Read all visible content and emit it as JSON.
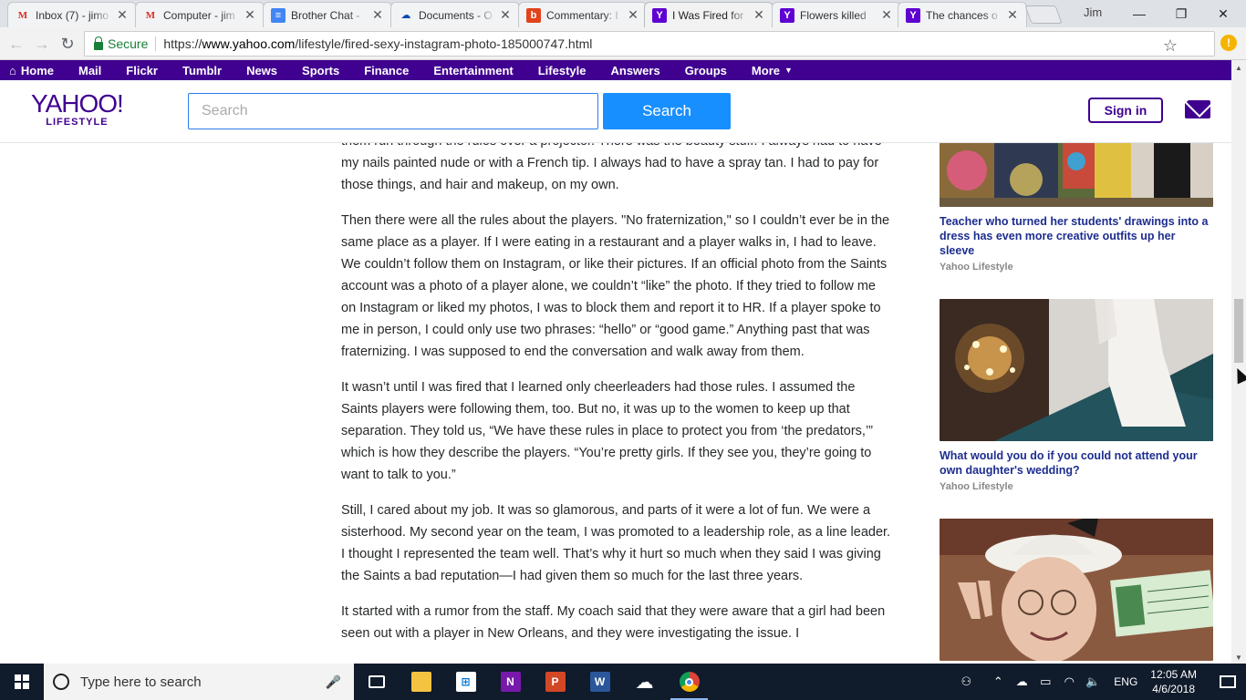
{
  "browser": {
    "tabs": [
      {
        "title": "Inbox (7) - jimo",
        "icon": "gmail-icon",
        "active": false
      },
      {
        "title": "Computer - jim",
        "icon": "gmail-icon",
        "active": false
      },
      {
        "title": "Brother Chat -",
        "icon": "google-docs-icon",
        "active": false
      },
      {
        "title": "Documents - O",
        "icon": "onedrive-icon",
        "active": false
      },
      {
        "title": "Commentary: I",
        "icon": "b-icon",
        "active": false
      },
      {
        "title": "I Was Fired for",
        "icon": "yahoo-icon",
        "active": true
      },
      {
        "title": "Flowers killed",
        "icon": "yahoo-icon",
        "active": false
      },
      {
        "title": "The chances o",
        "icon": "yahoo-icon",
        "active": false
      }
    ],
    "user_name": "Jim",
    "secure_label": "Secure",
    "url_scheme": "https://",
    "url_host": "www.yahoo.com",
    "url_path": "/lifestyle/fired-sexy-instagram-photo-185000747.html"
  },
  "yahoo_nav": {
    "items": [
      "Home",
      "Mail",
      "Flickr",
      "Tumblr",
      "News",
      "Sports",
      "Finance",
      "Entertainment",
      "Lifestyle",
      "Answers",
      "Groups",
      "More"
    ]
  },
  "header": {
    "logo_main": "YAHOO!",
    "logo_sub": "LIFESTYLE",
    "search_placeholder": "Search",
    "search_button": "Search",
    "signin_button": "Sign in"
  },
  "article": {
    "paragraphs": [
      "them run through the rules over a projector. There was the beauty stuff. I always had to have my nails painted nude or with a French tip. I always had to have a spray tan. I had to pay for those things, and hair and makeup, on my own.",
      "Then there were all the rules about the players. \"No fraternization,\" so I couldn’t ever be in the same place as a player. If I were eating in a restaurant and a player walks in, I had to leave. We couldn’t follow them on Instagram, or like their pictures. If an official photo from the Saints account was a photo of a player alone, we couldn’t “like” the photo. If they tried to follow me on Instagram or liked my photos, I was to block them and report it to HR. If a player spoke to me in person, I could only use two phrases: “hello” or “good game.” Anything past that was fraternizing. I was supposed to end the conversation and walk away from them.",
      "It wasn’t until I was fired that I learned only cheerleaders had those rules. I assumed the Saints players were following them, too. But no, it was up to the women to keep up that separation. They told us, “We have these rules in place to protect you from ‘the predators,’” which is how they describe the players. “You’re pretty girls. If they see you, they’re going to want to talk to you.”",
      "Still, I cared about my job. It was so glamorous, and parts of it were a lot of fun. We were a sisterhood. My second year on the team, I was promoted to a leadership role, as a line leader. I thought I represented the team well. That’s why it hurt so much when they said I was giving the Saints a bad reputation—I had given them so much for the last three years.",
      "It started with a rumor from the staff. My coach said that they were aware that a girl had been seen out with a player in New Orleans, and they were investigating the issue. I"
    ]
  },
  "sidebar": {
    "cards": [
      {
        "title": "Teacher who turned her students' drawings into a dress has even more creative outfits up her sleeve",
        "source": "Yahoo Lifestyle"
      },
      {
        "title": "What would you do if you could not attend your own daughter's wedding?",
        "source": "Yahoo Lifestyle"
      },
      {
        "title": "",
        "source": ""
      }
    ]
  },
  "taskbar": {
    "search_placeholder": "Type here to search",
    "language": "ENG",
    "time": "12:05 AM",
    "date": "4/6/2018"
  }
}
